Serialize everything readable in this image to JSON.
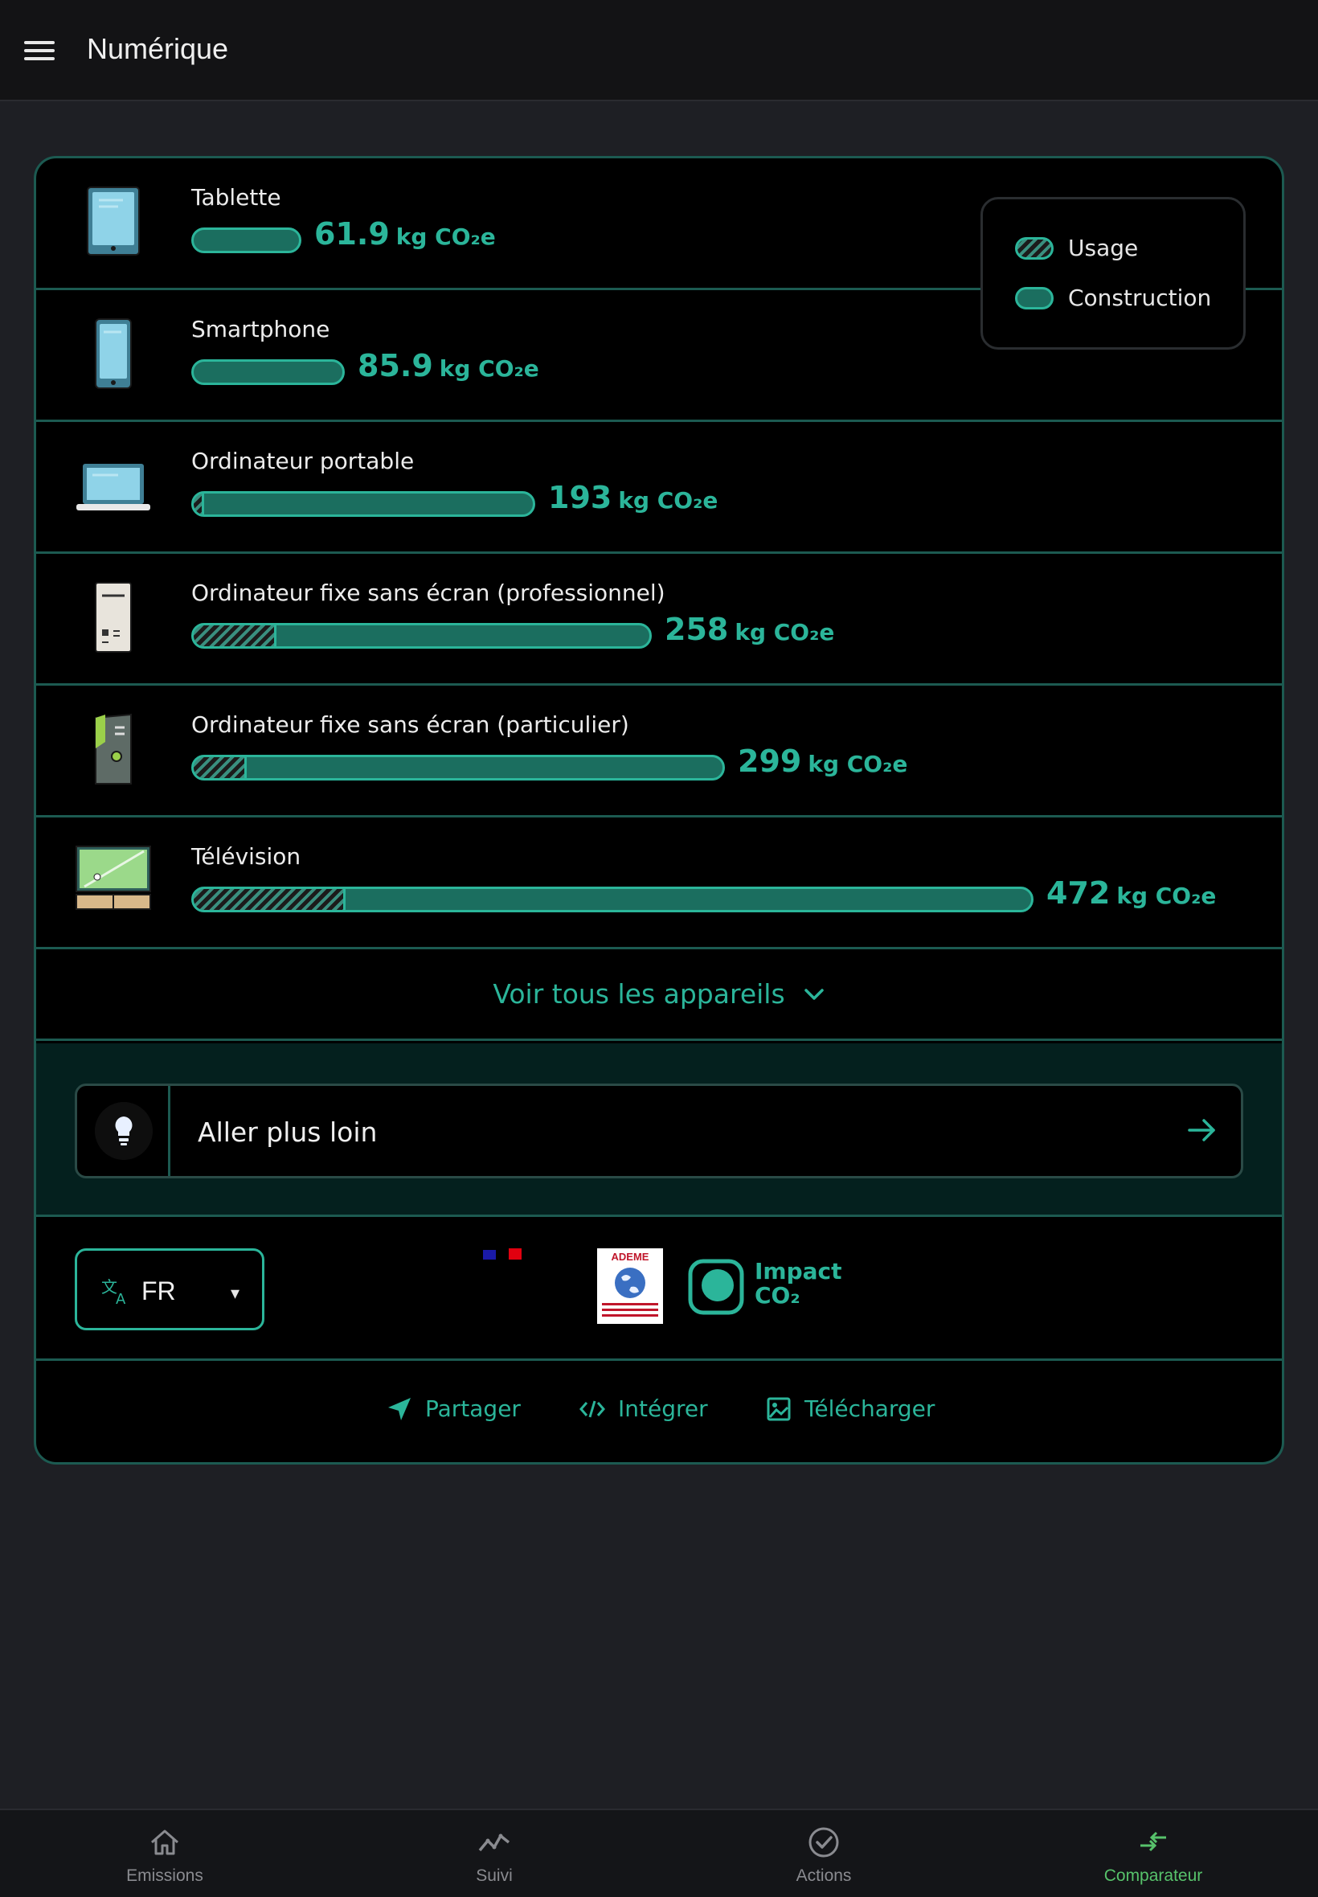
{
  "appbar": {
    "title": "Numérique"
  },
  "legend": {
    "usage": "Usage",
    "construction": "Construction"
  },
  "devices": [
    {
      "name": "Tablette",
      "value": "61.9",
      "unit": "kg CO₂e",
      "usage_fraction": 0.0
    },
    {
      "name": "Smartphone",
      "value": "85.9",
      "unit": "kg CO₂e",
      "usage_fraction": 0.0
    },
    {
      "name": "Ordinateur portable",
      "value": "193",
      "unit": "kg CO₂e",
      "usage_fraction": 0.03
    },
    {
      "name": "Ordinateur fixe sans écran (professionnel)",
      "value": "258",
      "unit": "kg CO₂e",
      "usage_fraction": 0.18
    },
    {
      "name": "Ordinateur fixe sans écran (particulier)",
      "value": "299",
      "unit": "kg CO₂e",
      "usage_fraction": 0.1
    },
    {
      "name": "Télévision",
      "value": "472",
      "unit": "kg CO₂e",
      "usage_fraction": 0.18
    }
  ],
  "see_all": "Voir tous les appareils",
  "further": {
    "label": "Aller plus loin"
  },
  "language": {
    "code": "FR",
    "caret": "▾"
  },
  "logos": {
    "ademe": "ADEME",
    "impact_line1": "Impact",
    "impact_line2": "CO₂"
  },
  "actions": {
    "share": "Partager",
    "embed": "Intégrer",
    "download": "Télécharger"
  },
  "nav": [
    {
      "label": "Emissions"
    },
    {
      "label": "Suivi"
    },
    {
      "label": "Actions"
    },
    {
      "label": "Comparateur"
    }
  ],
  "colors": {
    "accent": "#2bb59a",
    "border": "#1c5a51",
    "nav_active": "#57c26b"
  }
}
